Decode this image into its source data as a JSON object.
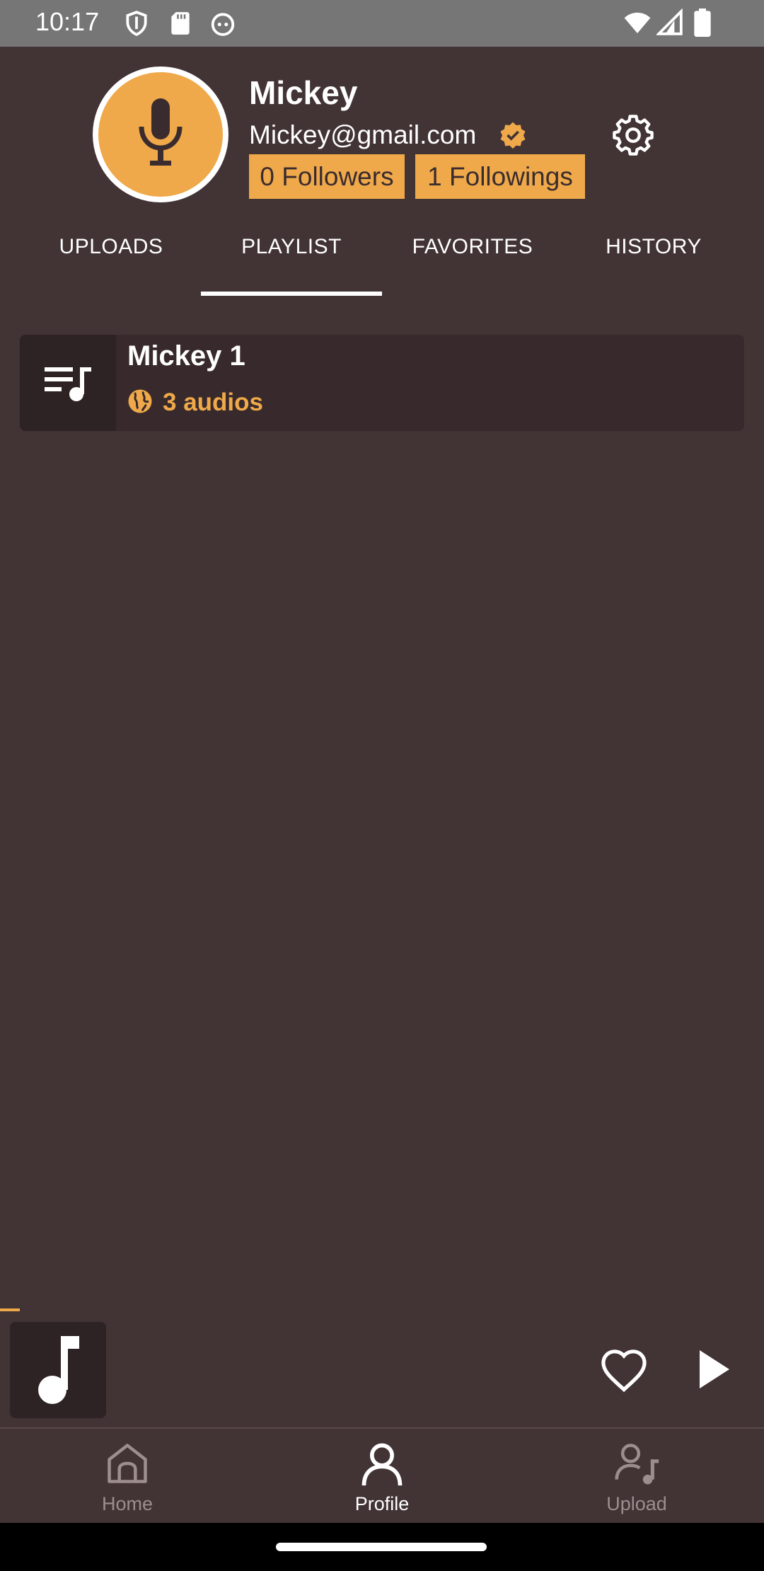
{
  "status_bar": {
    "time": "10:17"
  },
  "profile": {
    "name": "Mickey",
    "email": "Mickey@gmail.com",
    "followers": "0 Followers",
    "followings": "1 Followings"
  },
  "tabs": [
    {
      "label": "UPLOADS"
    },
    {
      "label": "PLAYLIST",
      "selected": true
    },
    {
      "label": "FAVORITES"
    },
    {
      "label": "HISTORY"
    }
  ],
  "playlists": [
    {
      "title": "Mickey 1",
      "count": "3 audios",
      "visibility_icon": "globe-icon"
    }
  ],
  "player": {
    "progress_fraction": 0.026
  },
  "bottom_nav": [
    {
      "label": "Home",
      "icon": "home-icon"
    },
    {
      "label": "Profile",
      "icon": "person-icon",
      "selected": true
    },
    {
      "label": "Upload",
      "icon": "upload-music-icon"
    }
  ],
  "colors": {
    "background": "#423335",
    "accent": "#efa94a",
    "card": "#382a2c",
    "status_bar": "#767676"
  }
}
